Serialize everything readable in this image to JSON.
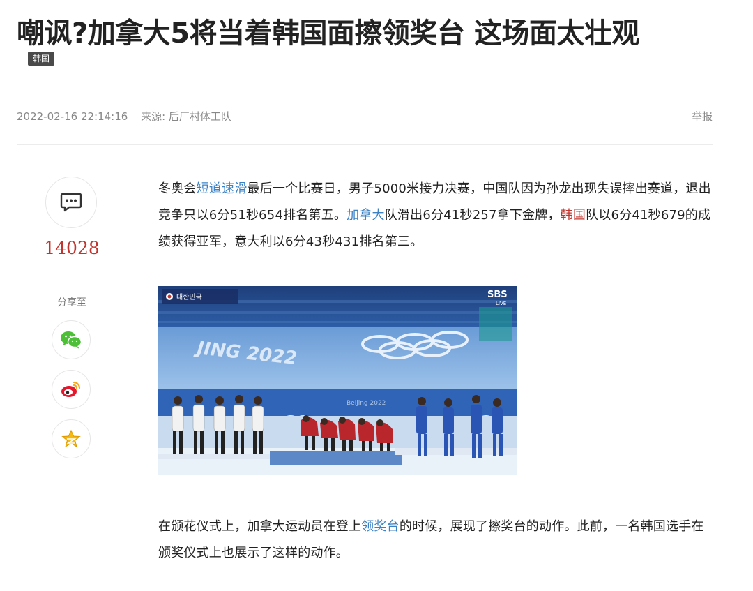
{
  "article": {
    "title": "嘲讽?加拿大5将当着韩国面擦领奖台 这场面太壮观",
    "tag": "韩国",
    "date": "2022-02-16 22:14:16",
    "source": "来源: 后厂村体工队",
    "report_label": "举报"
  },
  "sidebar": {
    "comment_count": "14028",
    "share_label": "分享至",
    "share_targets": [
      "wechat-icon",
      "weibo-icon",
      "qzone-icon"
    ]
  },
  "body": {
    "p1": {
      "s1": "冬奥会",
      "link1": "短道速滑",
      "s2": "最后一个比赛日，男子5000米接力决赛，中国队因为孙龙出现失误摔出赛道，退出竞争只以6分51秒654排名第五。",
      "link2": "加拿大",
      "s3": "队滑出6分41秒257拿下金牌，",
      "link3": "韩国",
      "s4": "队以6分41秒679的成绩获得亚军，意大利以6分43秒431排名第三。"
    },
    "photo": {
      "broadcaster": "SBS",
      "broadcaster_sub": "LIVE",
      "score_banner": "대한민국",
      "rink_text": "JING 2022",
      "venue_text": "Beijing 2022"
    },
    "p2": {
      "s1": "在颁花仪式上，加拿大运动员在登上",
      "link1": "领奖台",
      "s2": "的时候，展现了擦奖台的动作。此前，一名韩国选手在颁奖仪式上也展示了这样的动作。"
    }
  },
  "colors": {
    "accent_red": "#c2342d",
    "link_blue": "#3b82c4",
    "wechat_green": "#4cbf36",
    "weibo_red": "#e6162d",
    "qzone_yellow": "#f5b910"
  }
}
